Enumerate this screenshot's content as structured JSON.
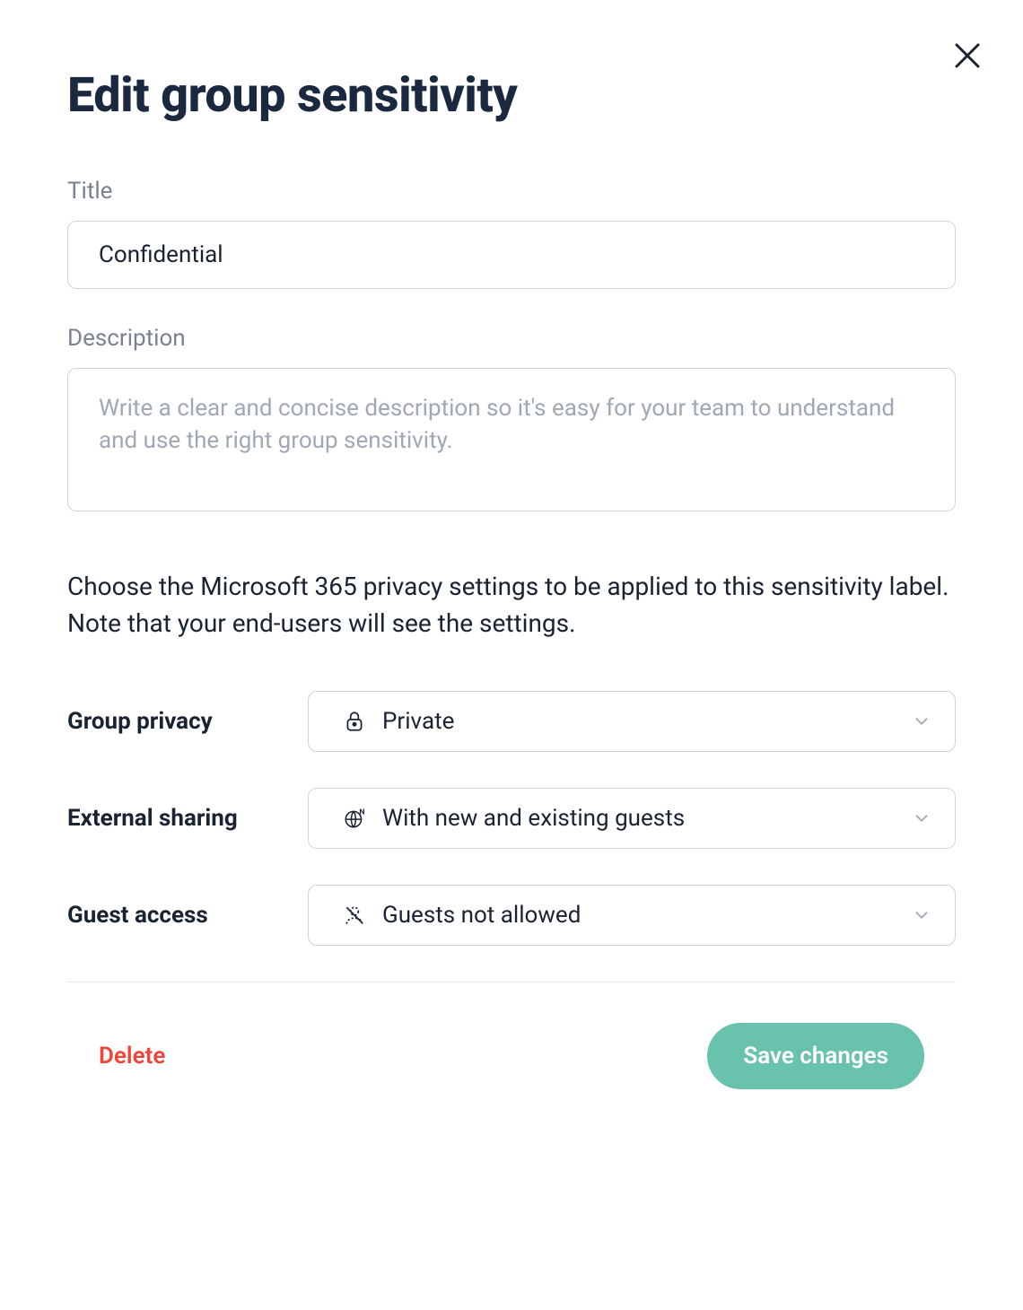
{
  "header": {
    "title": "Edit group sensitivity"
  },
  "form": {
    "title_label": "Title",
    "title_value": "Confidential",
    "description_label": "Description",
    "description_value": "",
    "description_placeholder": "Write a clear and concise description so it's easy for your team to understand and use the right group sensitivity."
  },
  "instruction": "Choose the Microsoft 365 privacy settings to be applied to this sensitivity label.\nNote that your end-users will see the settings.",
  "selects": {
    "group_privacy": {
      "label": "Group privacy",
      "value": "Private"
    },
    "external_sharing": {
      "label": "External sharing",
      "value": "With new and existing guests"
    },
    "guest_access": {
      "label": "Guest access",
      "value": "Guests not allowed"
    }
  },
  "actions": {
    "delete_label": "Delete",
    "save_label": "Save changes"
  }
}
